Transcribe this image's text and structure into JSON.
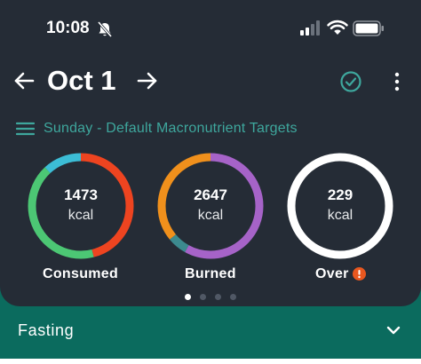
{
  "status_bar": {
    "time": "10:08"
  },
  "header": {
    "date": "Oct 1"
  },
  "targets": {
    "label": "Sunday - Default Macronutrient Targets"
  },
  "rings": [
    {
      "value": "1473",
      "unit": "kcal",
      "label": "Consumed",
      "segments": [
        {
          "color": "#ee4420",
          "fraction": 0.46
        },
        {
          "color": "#4cc774",
          "fraction": 0.42
        },
        {
          "color": "#3cbdd6",
          "fraction": 0.12
        }
      ]
    },
    {
      "value": "2647",
      "unit": "kcal",
      "label": "Burned",
      "segments": [
        {
          "color": "#a663c8",
          "fraction": 0.58
        },
        {
          "color": "#3c8a8f",
          "fraction": 0.06
        },
        {
          "color": "#f0901c",
          "fraction": 0.36
        }
      ]
    },
    {
      "value": "229",
      "unit": "kcal",
      "label": "Over",
      "segments": [
        {
          "color": "#ffffff",
          "fraction": 1.0
        }
      ]
    }
  ],
  "pager": {
    "pages": 4,
    "active": 0
  },
  "fasting": {
    "label": "Fasting"
  },
  "colors": {
    "card_bg": "#252c36",
    "accent": "#3ea79d",
    "fasting_bg": "#0b6b5e",
    "alert": "#e8571f"
  }
}
